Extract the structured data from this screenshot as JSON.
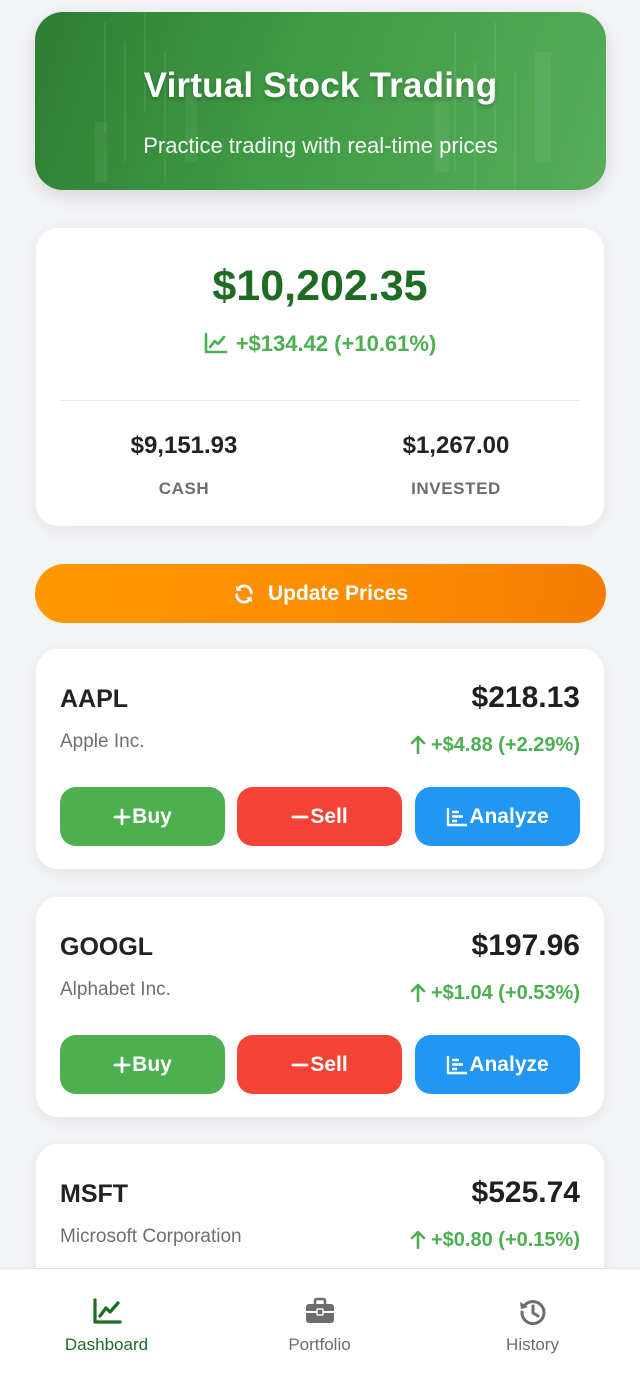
{
  "header": {
    "title": "Virtual Stock Trading",
    "subtitle": "Practice trading with real-time prices"
  },
  "balance": {
    "total": "$10,202.35",
    "change": "+$134.42 (+10.61%)",
    "change_icon": "chart-line-icon",
    "cash_value": "$9,151.93",
    "cash_label": "CASH",
    "invested_value": "$1,267.00",
    "invested_label": "INVESTED"
  },
  "update_button": {
    "label": "Update Prices",
    "icon": "sync-icon"
  },
  "actions": {
    "buy": "Buy",
    "sell": "Sell",
    "analyze": "Analyze"
  },
  "stocks": [
    {
      "ticker": "AAPL",
      "name": "Apple Inc.",
      "price": "$218.13",
      "change": "+$4.88 (+2.29%)",
      "direction": "up"
    },
    {
      "ticker": "GOOGL",
      "name": "Alphabet Inc.",
      "price": "$197.96",
      "change": "+$1.04 (+0.53%)",
      "direction": "up"
    },
    {
      "ticker": "MSFT",
      "name": "Microsoft Corporation",
      "price": "$525.74",
      "change": "+$0.80 (+0.15%)",
      "direction": "up"
    }
  ],
  "nav": [
    {
      "label": "Dashboard",
      "icon": "chart-line-icon",
      "active": true
    },
    {
      "label": "Portfolio",
      "icon": "briefcase-icon",
      "active": false
    },
    {
      "label": "History",
      "icon": "history-icon",
      "active": false
    }
  ],
  "colors": {
    "primary_green": "#1e6b23",
    "positive": "#4caf50",
    "buy": "#4caf50",
    "sell": "#f44336",
    "analyze": "#2196f3",
    "update": "#ff9800"
  }
}
